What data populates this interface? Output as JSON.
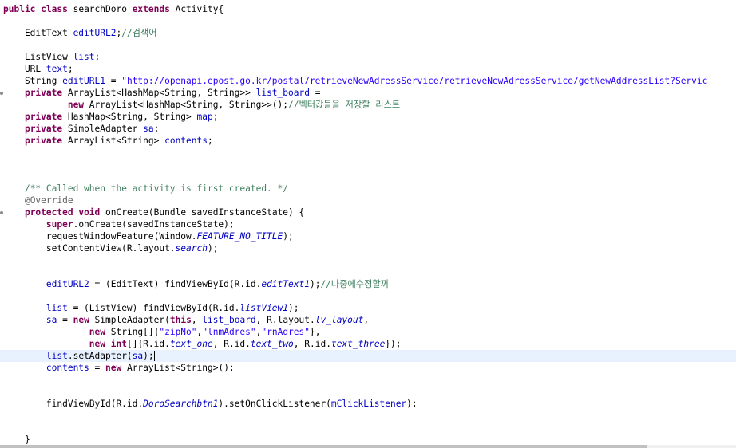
{
  "editor": {
    "current_line_index": 29,
    "lines": [
      [
        {
          "t": "kw",
          "v": "public"
        },
        {
          "t": "p",
          "v": " "
        },
        {
          "t": "kw",
          "v": "class"
        },
        {
          "t": "p",
          "v": " searchDoro "
        },
        {
          "t": "kw",
          "v": "extends"
        },
        {
          "t": "p",
          "v": " Activity{"
        }
      ],
      [],
      [
        {
          "t": "p",
          "v": "    EditText "
        },
        {
          "t": "fld",
          "v": "editURL2"
        },
        {
          "t": "p",
          "v": ";"
        },
        {
          "t": "cmt",
          "v": "//검색어"
        }
      ],
      [],
      [
        {
          "t": "p",
          "v": "    ListView "
        },
        {
          "t": "fld",
          "v": "list"
        },
        {
          "t": "p",
          "v": ";"
        }
      ],
      [
        {
          "t": "p",
          "v": "    URL "
        },
        {
          "t": "fld",
          "v": "text"
        },
        {
          "t": "p",
          "v": ";"
        }
      ],
      [
        {
          "t": "p",
          "v": "    String "
        },
        {
          "t": "fld",
          "v": "editURL1"
        },
        {
          "t": "p",
          "v": " = "
        },
        {
          "t": "str",
          "v": "\"http://openapi.epost.go.kr/postal/retrieveNewAdressService/retrieveNewAdressService/getNewAddressList?Servic"
        }
      ],
      [
        {
          "t": "p",
          "v": "    "
        },
        {
          "t": "kw",
          "v": "private"
        },
        {
          "t": "p",
          "v": " ArrayList<HashMap<String, String>> "
        },
        {
          "t": "fld",
          "v": "list_board"
        },
        {
          "t": "p",
          "v": " ="
        }
      ],
      [
        {
          "t": "p",
          "v": "            "
        },
        {
          "t": "kw",
          "v": "new"
        },
        {
          "t": "p",
          "v": " ArrayList<HashMap<String, String>>();"
        },
        {
          "t": "cmt",
          "v": "//벡터값들을 저장할 리스트"
        }
      ],
      [
        {
          "t": "p",
          "v": "    "
        },
        {
          "t": "kw",
          "v": "private"
        },
        {
          "t": "p",
          "v": " HashMap<String, String> "
        },
        {
          "t": "fld",
          "v": "map"
        },
        {
          "t": "p",
          "v": ";"
        }
      ],
      [
        {
          "t": "p",
          "v": "    "
        },
        {
          "t": "kw",
          "v": "private"
        },
        {
          "t": "p",
          "v": " SimpleAdapter "
        },
        {
          "t": "fld",
          "v": "sa"
        },
        {
          "t": "p",
          "v": ";"
        }
      ],
      [
        {
          "t": "p",
          "v": "    "
        },
        {
          "t": "kw",
          "v": "private"
        },
        {
          "t": "p",
          "v": " ArrayList<String> "
        },
        {
          "t": "fld",
          "v": "contents"
        },
        {
          "t": "p",
          "v": ";"
        }
      ],
      [],
      [],
      [],
      [
        {
          "t": "p",
          "v": "    "
        },
        {
          "t": "cmt",
          "v": "/** Called when the activity is first created. */"
        }
      ],
      [
        {
          "t": "p",
          "v": "    "
        },
        {
          "t": "ann",
          "v": "@Override"
        }
      ],
      [
        {
          "t": "p",
          "v": "    "
        },
        {
          "t": "kw",
          "v": "protected"
        },
        {
          "t": "p",
          "v": " "
        },
        {
          "t": "kw",
          "v": "void"
        },
        {
          "t": "p",
          "v": " onCreate(Bundle savedInstanceState) {"
        }
      ],
      [
        {
          "t": "p",
          "v": "        "
        },
        {
          "t": "kw",
          "v": "super"
        },
        {
          "t": "p",
          "v": ".onCreate(savedInstanceState);"
        }
      ],
      [
        {
          "t": "p",
          "v": "        requestWindowFeature(Window."
        },
        {
          "t": "cnst",
          "v": "FEATURE_NO_TITLE"
        },
        {
          "t": "p",
          "v": ");"
        }
      ],
      [
        {
          "t": "p",
          "v": "        setContentView(R.layout."
        },
        {
          "t": "cnst",
          "v": "search"
        },
        {
          "t": "p",
          "v": ");"
        }
      ],
      [],
      [],
      [
        {
          "t": "p",
          "v": "        "
        },
        {
          "t": "fld",
          "v": "editURL2"
        },
        {
          "t": "p",
          "v": " = (EditText) findViewById(R.id."
        },
        {
          "t": "cnst",
          "v": "editText1"
        },
        {
          "t": "p",
          "v": ");"
        },
        {
          "t": "cmt",
          "v": "//나중에수정할꺼"
        }
      ],
      [],
      [
        {
          "t": "p",
          "v": "        "
        },
        {
          "t": "fld",
          "v": "list"
        },
        {
          "t": "p",
          "v": " = (ListView) findViewById(R.id."
        },
        {
          "t": "cnst",
          "v": "listView1"
        },
        {
          "t": "p",
          "v": ");"
        }
      ],
      [
        {
          "t": "p",
          "v": "        "
        },
        {
          "t": "fld",
          "v": "sa"
        },
        {
          "t": "p",
          "v": " = "
        },
        {
          "t": "kw",
          "v": "new"
        },
        {
          "t": "p",
          "v": " SimpleAdapter("
        },
        {
          "t": "kw",
          "v": "this"
        },
        {
          "t": "p",
          "v": ", "
        },
        {
          "t": "fld",
          "v": "list_board"
        },
        {
          "t": "p",
          "v": ", R.layout."
        },
        {
          "t": "cnst",
          "v": "lv_layout"
        },
        {
          "t": "p",
          "v": ","
        }
      ],
      [
        {
          "t": "p",
          "v": "                "
        },
        {
          "t": "kw",
          "v": "new"
        },
        {
          "t": "p",
          "v": " String[]{"
        },
        {
          "t": "str",
          "v": "\"zipNo\""
        },
        {
          "t": "p",
          "v": ","
        },
        {
          "t": "str",
          "v": "\"lnmAdres\""
        },
        {
          "t": "p",
          "v": ","
        },
        {
          "t": "str",
          "v": "\"rnAdres\""
        },
        {
          "t": "p",
          "v": "},"
        }
      ],
      [
        {
          "t": "p",
          "v": "                "
        },
        {
          "t": "kw",
          "v": "new"
        },
        {
          "t": "p",
          "v": " "
        },
        {
          "t": "kw",
          "v": "int"
        },
        {
          "t": "p",
          "v": "[]{R.id."
        },
        {
          "t": "cnst",
          "v": "text_one"
        },
        {
          "t": "p",
          "v": ", R.id."
        },
        {
          "t": "cnst",
          "v": "text_two"
        },
        {
          "t": "p",
          "v": ", R.id."
        },
        {
          "t": "cnst",
          "v": "text_three"
        },
        {
          "t": "p",
          "v": "});"
        }
      ],
      [
        {
          "t": "p",
          "v": "        "
        },
        {
          "t": "fld",
          "v": "list"
        },
        {
          "t": "p",
          "v": ".setAdapter("
        },
        {
          "t": "fld",
          "v": "sa"
        },
        {
          "t": "p",
          "v": ");"
        }
      ],
      [
        {
          "t": "p",
          "v": "        "
        },
        {
          "t": "fld",
          "v": "contents"
        },
        {
          "t": "p",
          "v": " = "
        },
        {
          "t": "kw",
          "v": "new"
        },
        {
          "t": "p",
          "v": " ArrayList<String>();"
        }
      ],
      [],
      [],
      [
        {
          "t": "p",
          "v": "        findViewById(R.id."
        },
        {
          "t": "cnst",
          "v": "DoroSearchbtn1"
        },
        {
          "t": "p",
          "v": ").setOnClickListener("
        },
        {
          "t": "fld",
          "v": "mClickListener"
        },
        {
          "t": "p",
          "v": ");"
        }
      ],
      [],
      [],
      [
        {
          "t": "p",
          "v": "    }"
        }
      ]
    ]
  }
}
